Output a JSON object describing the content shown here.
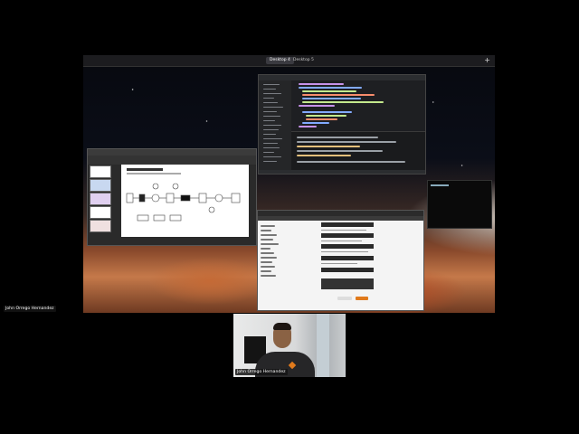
{
  "shared_screen": {
    "desktops": [
      "Desktop 4",
      "Desktop 5"
    ],
    "active_desktop": "Desktop 4",
    "add_desktop": "+",
    "windows": {
      "code_editor": {
        "icon": "code-editor-icon"
      },
      "slides": {
        "icon": "presentation-icon"
      },
      "browser": {
        "icon": "browser-icon"
      },
      "terminal": {
        "icon": "terminal-icon"
      }
    }
  },
  "participants": {
    "tile_label": "John Orrego Hernandez",
    "self_label": "John Orrego Hernandez"
  },
  "colors": {
    "background": "#000000",
    "accent_orange": "#e07a1c"
  }
}
